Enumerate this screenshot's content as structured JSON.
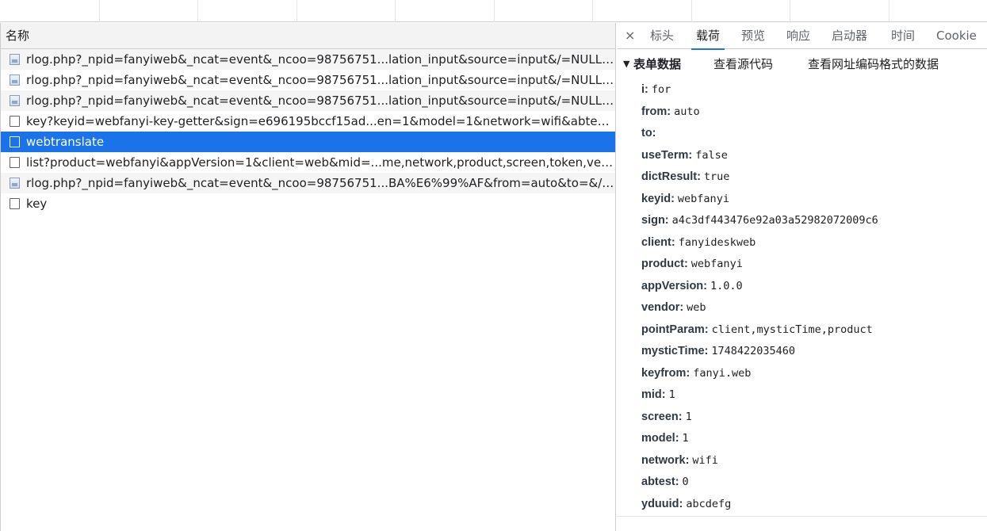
{
  "left": {
    "header": "名称",
    "rows": [
      {
        "text": "rlog.php?_npid=fanyiweb&_ncat=event&_ncoo=98756751...lation_input&source=input&/=NULL&sc...",
        "icon": "image-icon",
        "state": "alt"
      },
      {
        "text": "rlog.php?_npid=fanyiweb&_ncat=event&_ncoo=98756751...lation_input&source=input&/=NULL&sc...",
        "icon": "image-icon",
        "state": ""
      },
      {
        "text": "rlog.php?_npid=fanyiweb&_ncat=event&_ncoo=98756751...lation_input&source=input&/=NULL&sc...",
        "icon": "image-icon",
        "state": "alt"
      },
      {
        "text": "key?keyid=webfanyi-key-getter&sign=e696195bccf15ad...en=1&model=1&network=wifi&abtest=0...",
        "icon": "document-icon",
        "state": ""
      },
      {
        "text": "webtranslate",
        "icon": "document-icon",
        "state": "selected"
      },
      {
        "text": "list?product=webfanyi&appVersion=1&client=web&mid=...me,network,product,screen,token,vendor,...",
        "icon": "document-icon",
        "state": ""
      },
      {
        "text": "rlog.php?_npid=fanyiweb&_ncat=event&_ncoo=98756751...BA%E6%99%AF&from=auto&to=&/=N...",
        "icon": "image-icon",
        "state": "alt"
      },
      {
        "text": "key",
        "icon": "document-icon",
        "state": ""
      }
    ]
  },
  "right": {
    "close": "×",
    "tabs": [
      "标头",
      "载荷",
      "预览",
      "响应",
      "启动器",
      "时间",
      "Cookie"
    ],
    "active_tab": "载荷",
    "section": {
      "caret": "▼",
      "title": "表单数据",
      "view_source": "查看源代码",
      "view_url_encoded": "查看网址编码格式的数据"
    },
    "fields": [
      {
        "key": "i:",
        "value": "for"
      },
      {
        "key": "from:",
        "value": "auto"
      },
      {
        "key": "to:",
        "value": ""
      },
      {
        "key": "useTerm:",
        "value": "false"
      },
      {
        "key": "dictResult:",
        "value": "true"
      },
      {
        "key": "keyid:",
        "value": "webfanyi"
      },
      {
        "key": "sign:",
        "value": "a4c3df443476e92a03a52982072009c6"
      },
      {
        "key": "client:",
        "value": "fanyideskweb"
      },
      {
        "key": "product:",
        "value": "webfanyi"
      },
      {
        "key": "appVersion:",
        "value": "1.0.0"
      },
      {
        "key": "vendor:",
        "value": "web"
      },
      {
        "key": "pointParam:",
        "value": "client,mysticTime,product"
      },
      {
        "key": "mysticTime:",
        "value": "1748422035460"
      },
      {
        "key": "keyfrom:",
        "value": "fanyi.web"
      },
      {
        "key": "mid:",
        "value": "1"
      },
      {
        "key": "screen:",
        "value": "1"
      },
      {
        "key": "model:",
        "value": "1"
      },
      {
        "key": "network:",
        "value": "wifi"
      },
      {
        "key": "abtest:",
        "value": "0"
      },
      {
        "key": "yduuid:",
        "value": "abcdefg"
      }
    ]
  },
  "colors": {
    "selected_row": "#1a73e8",
    "active_tab_underline": "#1a73e8"
  }
}
